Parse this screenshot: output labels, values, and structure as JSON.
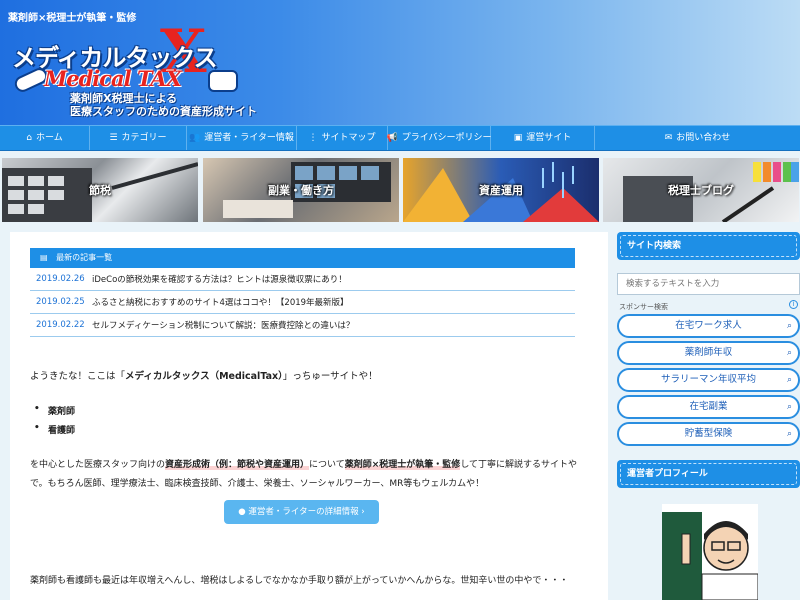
{
  "header": {
    "tagline": "薬剤師×税理士が執筆・監修",
    "logo": {
      "title": "メディカルタックス",
      "x_mark": "X",
      "en": "Medical TAX",
      "sub1": "薬剤師X税理士による",
      "sub2": "医療スタッフのための資産形成サイト"
    }
  },
  "nav": {
    "items": [
      {
        "icon": "home-icon",
        "glyph": "⌂",
        "label": "ホーム"
      },
      {
        "icon": "list-icon",
        "glyph": "☰",
        "label": "カテゴリー"
      },
      {
        "icon": "users-icon",
        "glyph": "👥",
        "label": "運営者・ライター情報"
      },
      {
        "icon": "sitemap-icon",
        "glyph": "⋮",
        "label": "サイトマップ"
      },
      {
        "icon": "megaphone-icon",
        "glyph": "📢",
        "label": "プライバシーポリシー"
      },
      {
        "icon": "badge-icon",
        "glyph": "▣",
        "label": "運営サイト"
      },
      {
        "icon": "mail-icon",
        "glyph": "✉",
        "label": "お問い合わせ"
      }
    ]
  },
  "categories": [
    {
      "label": "節税"
    },
    {
      "label": "副業・働き方"
    },
    {
      "label": "資産運用"
    },
    {
      "label": "税理士ブログ"
    }
  ],
  "recent": {
    "heading": "最新の記事一覧",
    "items": [
      {
        "date": "2019.02.26",
        "title": "iDeCoの節税効果を確認する方法は？ヒントは源泉徴収票にあり！"
      },
      {
        "date": "2019.02.25",
        "title": "ふるさと納税におすすめのサイト4選はココや！【2019年最新版】"
      },
      {
        "date": "2019.02.22",
        "title": "セルフメディケーション税制について解説：医療費控除との違いは？"
      }
    ]
  },
  "intro": {
    "before": "ようきたな！ここは「",
    "bold": "メディカルタックス（MedicalTax）",
    "after": "」っちゅーサイトや！"
  },
  "bullets": [
    "薬剤師",
    "看護師"
  ],
  "para": {
    "p1": "を中心とした医療スタッフ向けの",
    "hl1": "資産形成術（例：節税や資産運用）",
    "p2": "について",
    "hl2": "薬剤師×税理士が執筆・監修",
    "p3": "して丁寧に解説するサイトやで。もちろん医師、理学療法士、臨床検査技師、介護士、栄養士、ソーシャルワーカー、MR等もウェルカムや！"
  },
  "cta": {
    "label": "運営者・ライターの詳細情報  ›"
  },
  "para2": "薬剤師も看護師も最近は年収増えへんし、増税はしよるしでなかなか手取り額が上がっていかへんからな。世知辛い世の中やで・・・",
  "sidebar": {
    "search_heading": "サイト内検索",
    "search_placeholder": "検索するテキストを入力",
    "sponsor_label": "スポンサー検索",
    "sponsor_items": [
      "在宅ワーク求人",
      "薬剤師年収",
      "サラリーマン年収平均",
      "在宅副業",
      "貯蓄型保険"
    ],
    "profile_heading": "運営者プロフィール"
  },
  "colors": {
    "accent": "#1e8fe6",
    "date": "#1e73d6",
    "logo_red": "#e8231f",
    "highlight": "#fbd3d3"
  }
}
